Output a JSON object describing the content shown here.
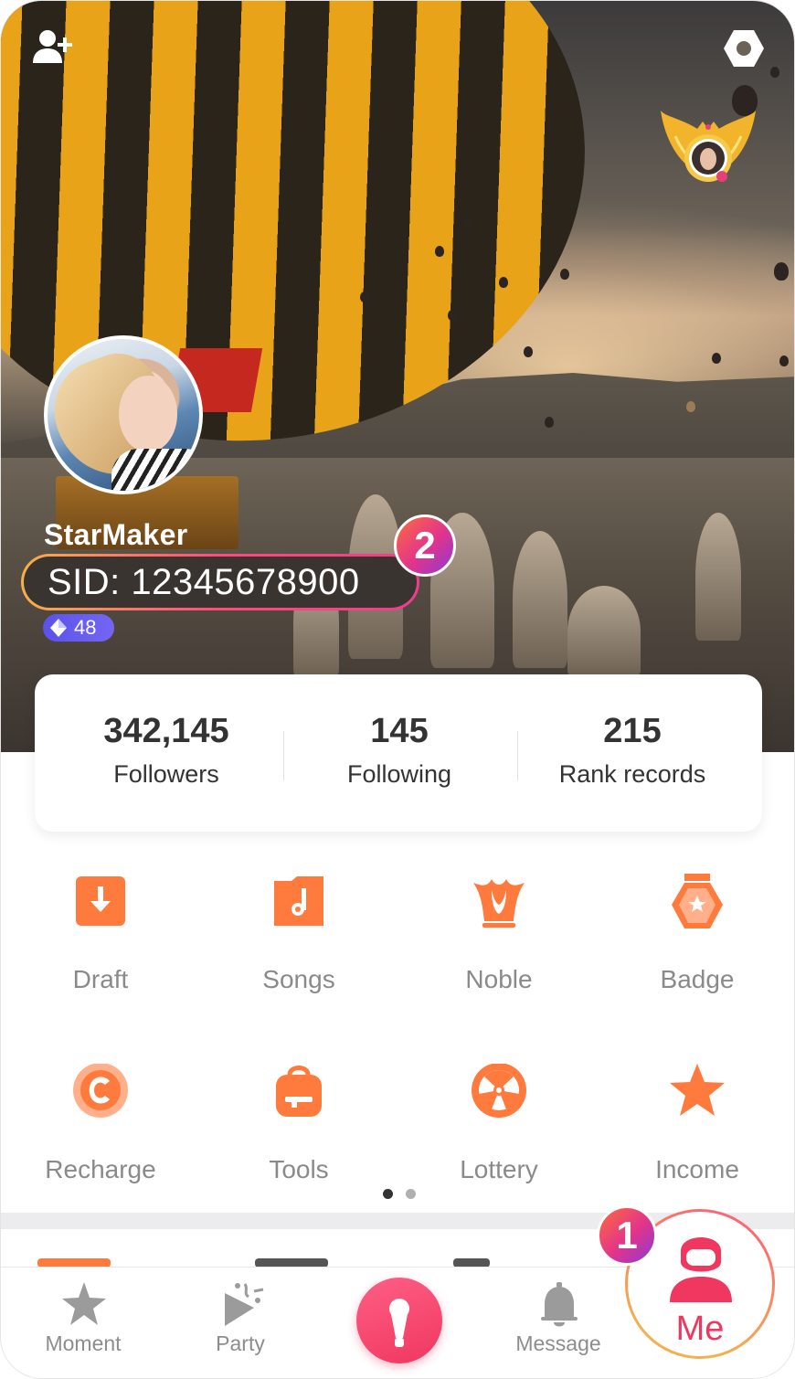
{
  "profile": {
    "username": "StarMaker",
    "sid": "SID: 12345678900",
    "level": "48"
  },
  "stats": [
    {
      "value": "342,145",
      "label": "Followers"
    },
    {
      "value": "145",
      "label": "Following"
    },
    {
      "value": "215",
      "label": "Rank records"
    }
  ],
  "menu": [
    {
      "label": "Draft",
      "icon": "draft-icon"
    },
    {
      "label": "Songs",
      "icon": "songs-icon"
    },
    {
      "label": "Noble",
      "icon": "noble-crown-icon"
    },
    {
      "label": "Badge",
      "icon": "badge-icon"
    },
    {
      "label": "Recharge",
      "icon": "recharge-coin-icon"
    },
    {
      "label": "Tools",
      "icon": "tools-bag-icon"
    },
    {
      "label": "Lottery",
      "icon": "lottery-wheel-icon"
    },
    {
      "label": "Income",
      "icon": "income-star-icon"
    }
  ],
  "pager": {
    "page_count": 2,
    "active_page": 1
  },
  "nav": {
    "moment": "Moment",
    "party": "Party",
    "message": "Message",
    "me": "Me"
  },
  "annotations": {
    "badge_1": "1",
    "badge_2": "2"
  },
  "colors": {
    "accent_orange": "#ff7a3d",
    "accent_pink": "#f0375f",
    "level_purple": "#5a53e8",
    "label_gray": "#8a8a8a"
  }
}
